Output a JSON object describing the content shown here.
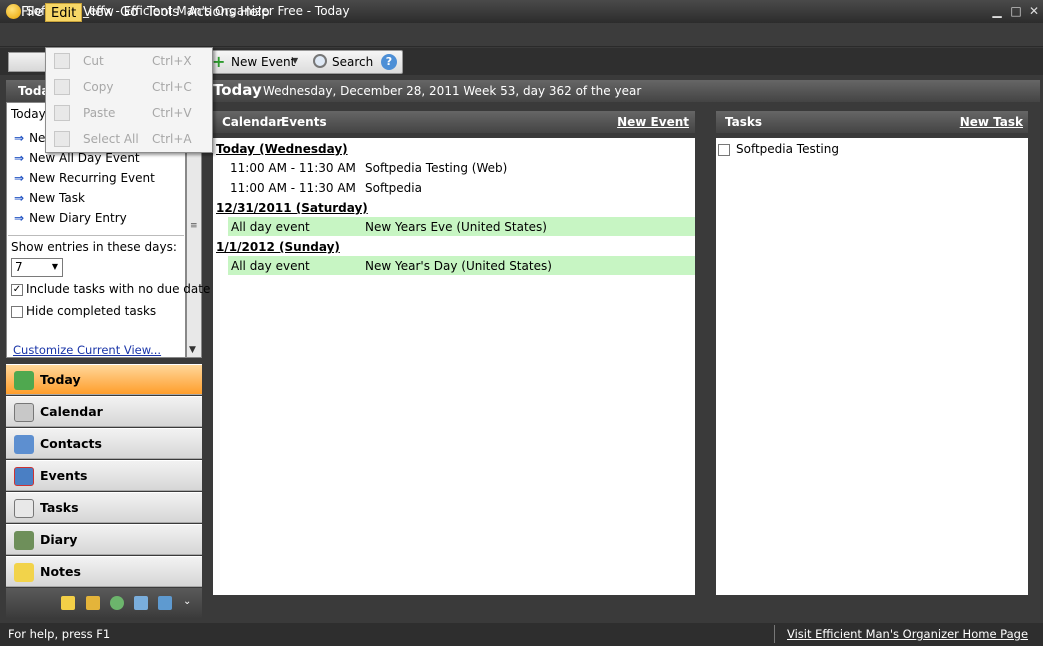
{
  "window": {
    "title": "Softpedia_effx - Efficient Man's Organizer Free - Today"
  },
  "menubar": {
    "items": [
      "File",
      "Edit",
      "View",
      "Go",
      "Tools",
      "Actions",
      "Help"
    ]
  },
  "toolbar": {
    "new_event": "New Event",
    "search": "Search",
    "help_glyph": "?"
  },
  "edit_menu": {
    "items": [
      {
        "label": "Cut",
        "shortcut": "Ctrl+X"
      },
      {
        "label": "Copy",
        "shortcut": "Ctrl+C"
      },
      {
        "label": "Paste",
        "shortcut": "Ctrl+V"
      },
      {
        "label": "Select All",
        "shortcut": "Ctrl+A"
      }
    ]
  },
  "left_panel": {
    "header": "Today",
    "subheader": "Today",
    "actions": [
      "New Event",
      "New All Day Event",
      "New Recurring Event",
      "New Task",
      "New Diary Entry"
    ],
    "show_entries_label": "Show entries in these days:",
    "days_value": "7",
    "include_no_due": "Include tasks with no due date",
    "include_no_due_checked": true,
    "hide_completed": "Hide completed tasks",
    "hide_completed_checked": false,
    "customize_link": "Customize Current View..."
  },
  "nav": {
    "items": [
      "Today",
      "Calendar",
      "Contacts",
      "Events",
      "Tasks",
      "Diary",
      "Notes"
    ],
    "active": "Today"
  },
  "main": {
    "title": "Today",
    "date_line": "Wednesday, December 28, 2011   Week 53, day 362 of the year"
  },
  "calendar_events": {
    "header_calendar": "Calendar",
    "header_events": "Events",
    "new_event_link": "New Event",
    "day1": "Today (Wednesday)",
    "e1_time": "11:00 AM - 11:30 AM",
    "e1_title": "Softpedia Testing (Web)",
    "e2_time": "11:00 AM - 11:30 AM",
    "e2_title": "Softpedia",
    "day2": "12/31/2011 (Saturday)",
    "e3_time": "All day event",
    "e3_title": "New Years Eve (United States)",
    "day3": "1/1/2012 (Sunday)",
    "e4_time": "All day event",
    "e4_title": "New Year's Day (United States)"
  },
  "tasks": {
    "header": "Tasks",
    "new_task_link": "New Task",
    "items": [
      "Softpedia Testing"
    ]
  },
  "statusbar": {
    "help": "For help, press F1",
    "homepage_link": "Visit Efficient Man's Organizer Home Page"
  },
  "colors": {
    "accent_orange": "#ff9e2c",
    "allday_green": "#c7f5c3",
    "menu_highlight": "#f7d766"
  }
}
